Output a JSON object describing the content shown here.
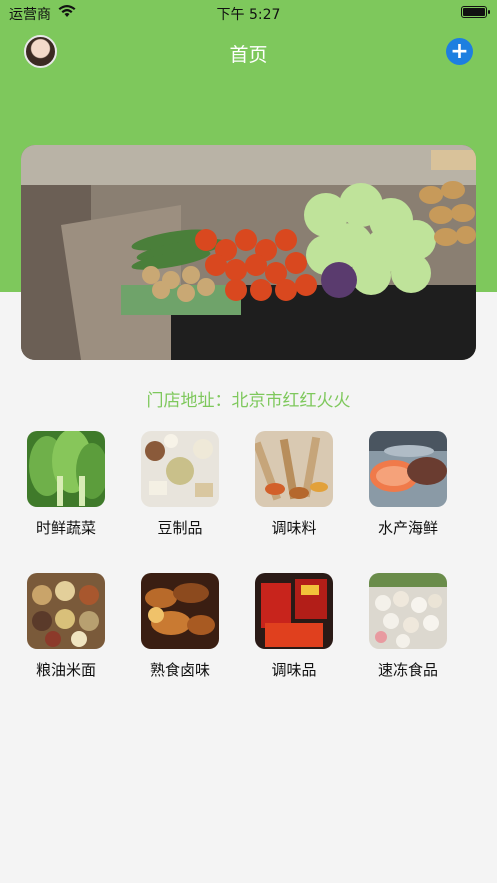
{
  "status_bar": {
    "carrier": "运营商",
    "time": "下午 5:27"
  },
  "nav": {
    "title": "首页",
    "add_icon": "plus-circle-icon"
  },
  "banner": {
    "description_icon": "market-produce-photo"
  },
  "address": "门店地址：北京市红红火火",
  "categories": [
    {
      "label": "时鲜蔬菜"
    },
    {
      "label": "豆制品"
    },
    {
      "label": "调味料"
    },
    {
      "label": "水产海鲜"
    },
    {
      "label": "粮油米面"
    },
    {
      "label": "熟食卤味"
    },
    {
      "label": "调味品"
    },
    {
      "label": "速冻食品"
    }
  ],
  "colors": {
    "header_green": "#7ec85c",
    "accent_blue": "#1d7fe0",
    "address_green": "#7ec85c"
  }
}
